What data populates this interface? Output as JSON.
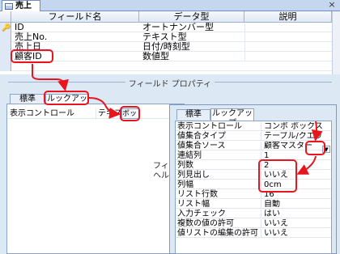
{
  "window": {
    "tab_title": "売上",
    "close_glyph": "×"
  },
  "grid": {
    "headers": {
      "field_name": "フィールド名",
      "data_type": "データ型",
      "description": "説明"
    },
    "rows": [
      {
        "name": "ID",
        "type": "オートナンバー型"
      },
      {
        "name": "売上No.",
        "type": "テキスト型"
      },
      {
        "name": "売上日",
        "type": "日付/時刻型"
      },
      {
        "name": "顧客ID",
        "type": "数値型"
      }
    ],
    "key_glyph": "🔑"
  },
  "properties": {
    "title": "フィールド プロパティ",
    "tabs": {
      "general": "標準",
      "lookup": "ルックアップ"
    },
    "back_row": {
      "label": "表示コントロール",
      "value": "テキスト"
    },
    "back_dropdown_text": "ボッ",
    "side_text": "フィー\nヘル",
    "front_tabs": {
      "general": "標準",
      "lookup": "ルックアップ"
    },
    "front_rows": [
      {
        "label": "表示コントロール",
        "value": "コンボ ボックス"
      },
      {
        "label": "値集合タイプ",
        "value": "テーブル/クエリ"
      },
      {
        "label": "値集合ソース",
        "value": "顧客マスター"
      },
      {
        "label": "連結列",
        "value": "1"
      },
      {
        "label": "列数",
        "value": "2"
      },
      {
        "label": "列見出し",
        "value": "いいえ"
      },
      {
        "label": "列幅",
        "value": "0cm"
      },
      {
        "label": "リスト行数",
        "value": "16"
      },
      {
        "label": "リスト幅",
        "value": "自動"
      },
      {
        "label": "入力チェック",
        "value": "はい"
      },
      {
        "label": "複数の値の許可",
        "value": "いいえ"
      },
      {
        "label": "値リストの編集の許可",
        "value": "いいえ"
      }
    ]
  },
  "colors": {
    "annotation": "#e8141e",
    "accent": "#6f8fbf"
  }
}
